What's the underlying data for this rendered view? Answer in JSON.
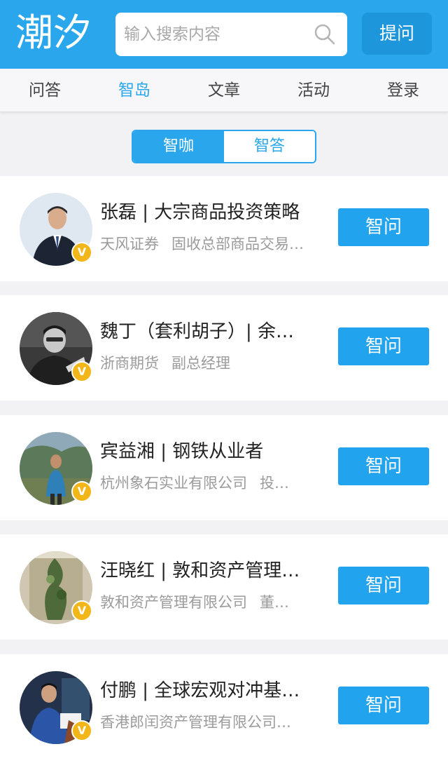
{
  "header": {
    "logo_text": "潮汐",
    "search_placeholder": "输入搜索内容",
    "ask_button": "提问",
    "brand_color": "#2aa7ec"
  },
  "nav": {
    "items": [
      {
        "label": "问答",
        "active": false
      },
      {
        "label": "智岛",
        "active": true
      },
      {
        "label": "文章",
        "active": false
      },
      {
        "label": "活动",
        "active": false
      },
      {
        "label": "登录",
        "active": false
      }
    ]
  },
  "toggle": {
    "left_label": "智咖",
    "right_label": "智答",
    "selected": "智咖"
  },
  "experts": [
    {
      "name_title": "张磊 | 大宗商品投资策略",
      "org": "天风证券",
      "role": "固收总部商品交易…",
      "button": "智问",
      "badge": "V"
    },
    {
      "name_title": "魏丁（套利胡子）| 余…",
      "org": "浙商期货",
      "role": "副总经理",
      "button": "智问",
      "badge": "V"
    },
    {
      "name_title": "宾益湘 | 钢铁从业者",
      "org": "杭州象石实业有限公司",
      "role": "投…",
      "button": "智问",
      "badge": "V"
    },
    {
      "name_title": "汪晓红 | 敦和资产管理…",
      "org": "敦和资产管理有限公司",
      "role": "董…",
      "button": "智问",
      "badge": "V"
    },
    {
      "name_title": "付鹏 | 全球宏观对冲基…",
      "org": "香港郎闰资产管理有限公司…",
      "role": "",
      "button": "智问",
      "badge": "V"
    }
  ]
}
